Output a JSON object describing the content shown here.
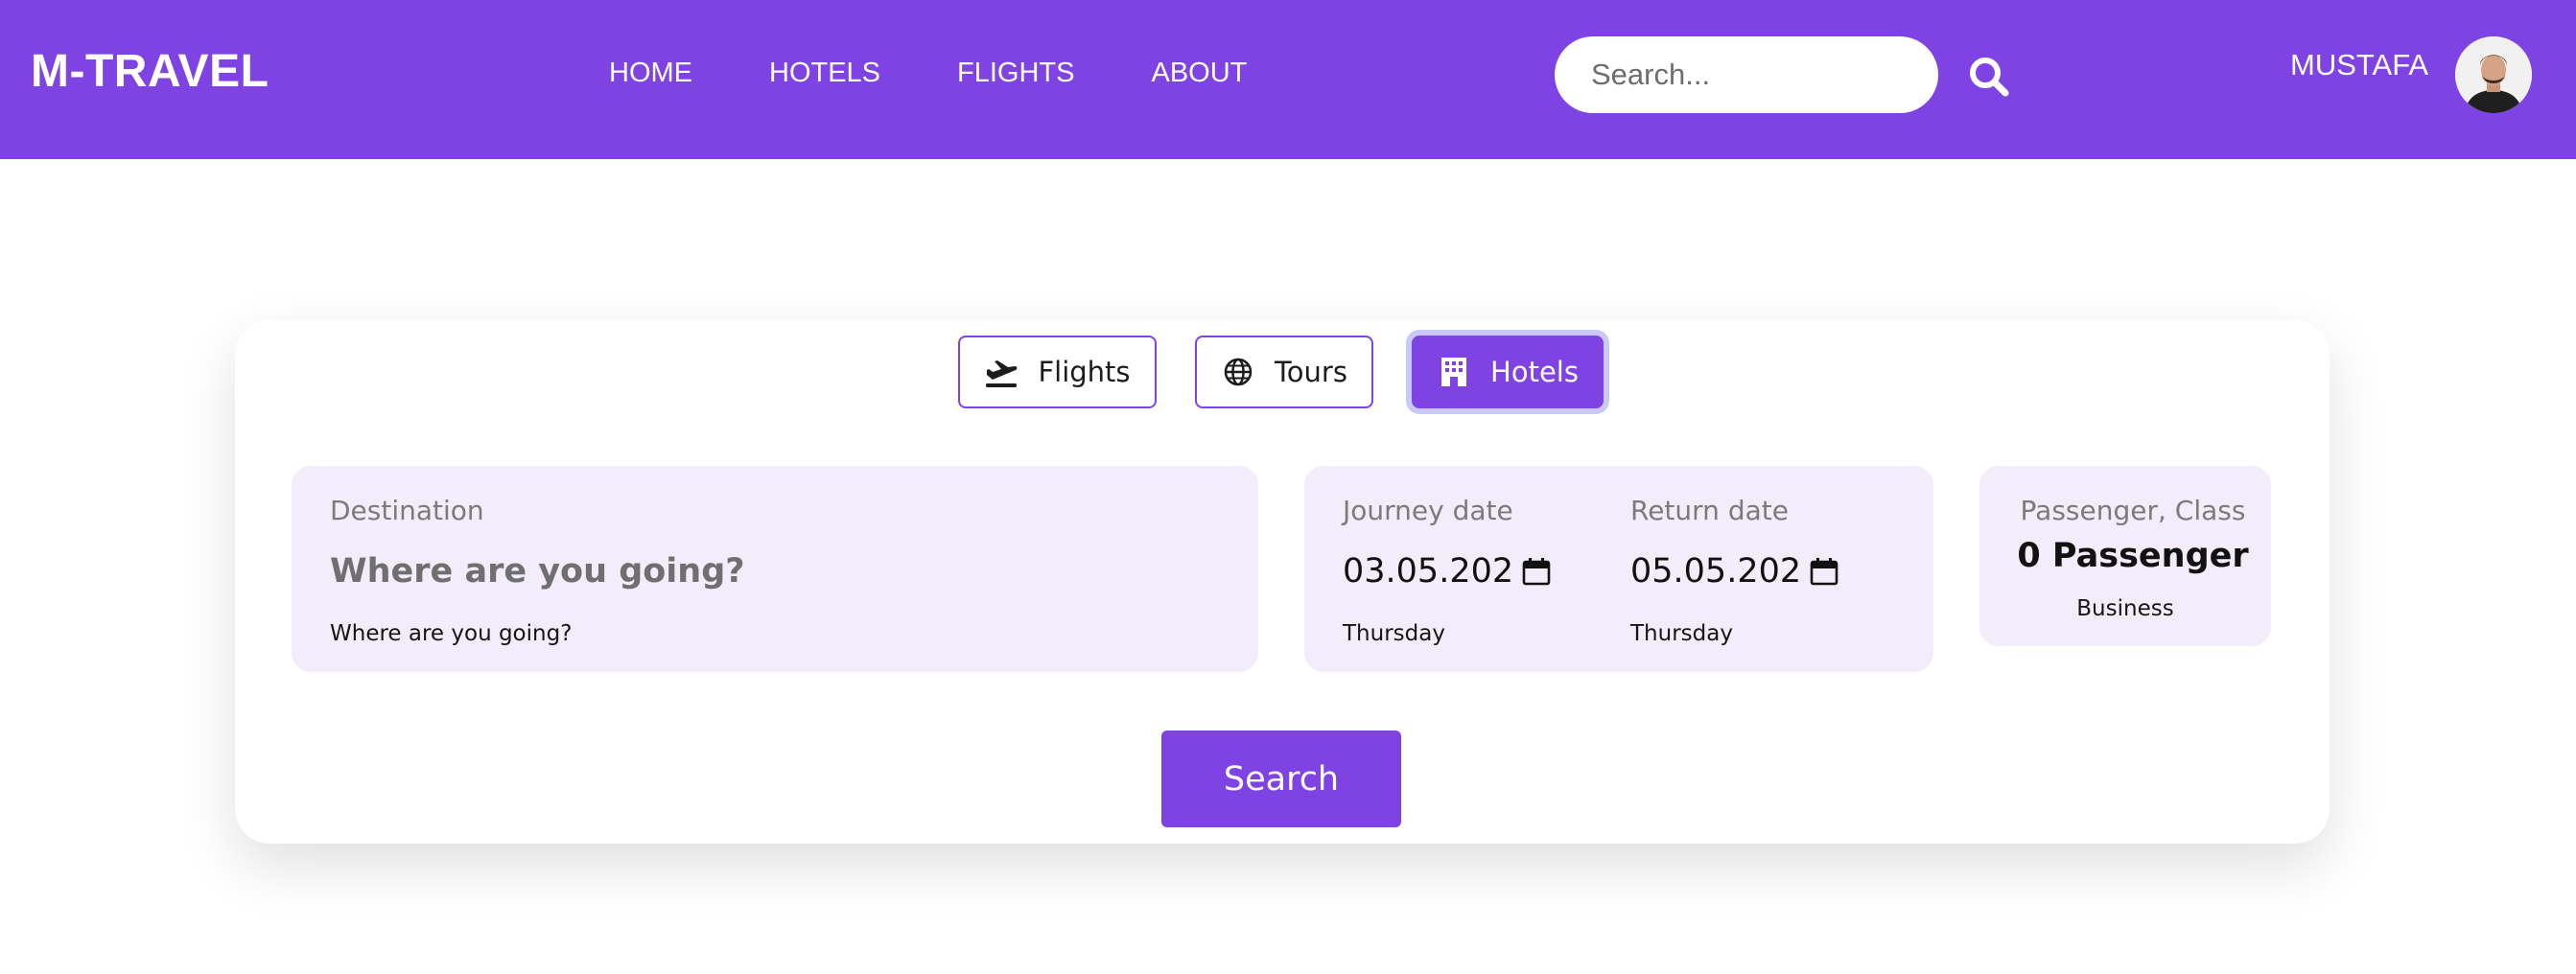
{
  "brand": {
    "name": "M-TRAVEL"
  },
  "nav": {
    "links": [
      "HOME",
      "HOTELS",
      "FLIGHTS",
      "ABOUT"
    ]
  },
  "search": {
    "placeholder": "Search...",
    "icon": "magnifying-glass"
  },
  "user": {
    "name": "MUSTAFA",
    "avatar_icon": "user-photo"
  },
  "tabs": [
    {
      "label": "Flights",
      "icon": "plane-departure",
      "active": false
    },
    {
      "label": "Tours",
      "icon": "globe",
      "active": false
    },
    {
      "label": "Hotels",
      "icon": "hotel-building",
      "active": true
    }
  ],
  "destination": {
    "label": "Destination",
    "value": "Where are you going?",
    "hint": "Where are you going?"
  },
  "journey": {
    "label": "Journey date",
    "date": "03.05.202",
    "day": "Thursday",
    "icon": "calendar"
  },
  "return": {
    "label": "Return date",
    "date": "05.05.202",
    "day": "Thursday",
    "icon": "calendar"
  },
  "passenger": {
    "label": "Passenger, Class",
    "count": "0 Passenger",
    "class": "Business"
  },
  "actions": {
    "search_label": "Search"
  },
  "colors": {
    "primary": "#8043e3",
    "panel_bg": "#f2ecfb",
    "focus_ring": "#c9c8f6",
    "text": "#1c1c1c"
  }
}
